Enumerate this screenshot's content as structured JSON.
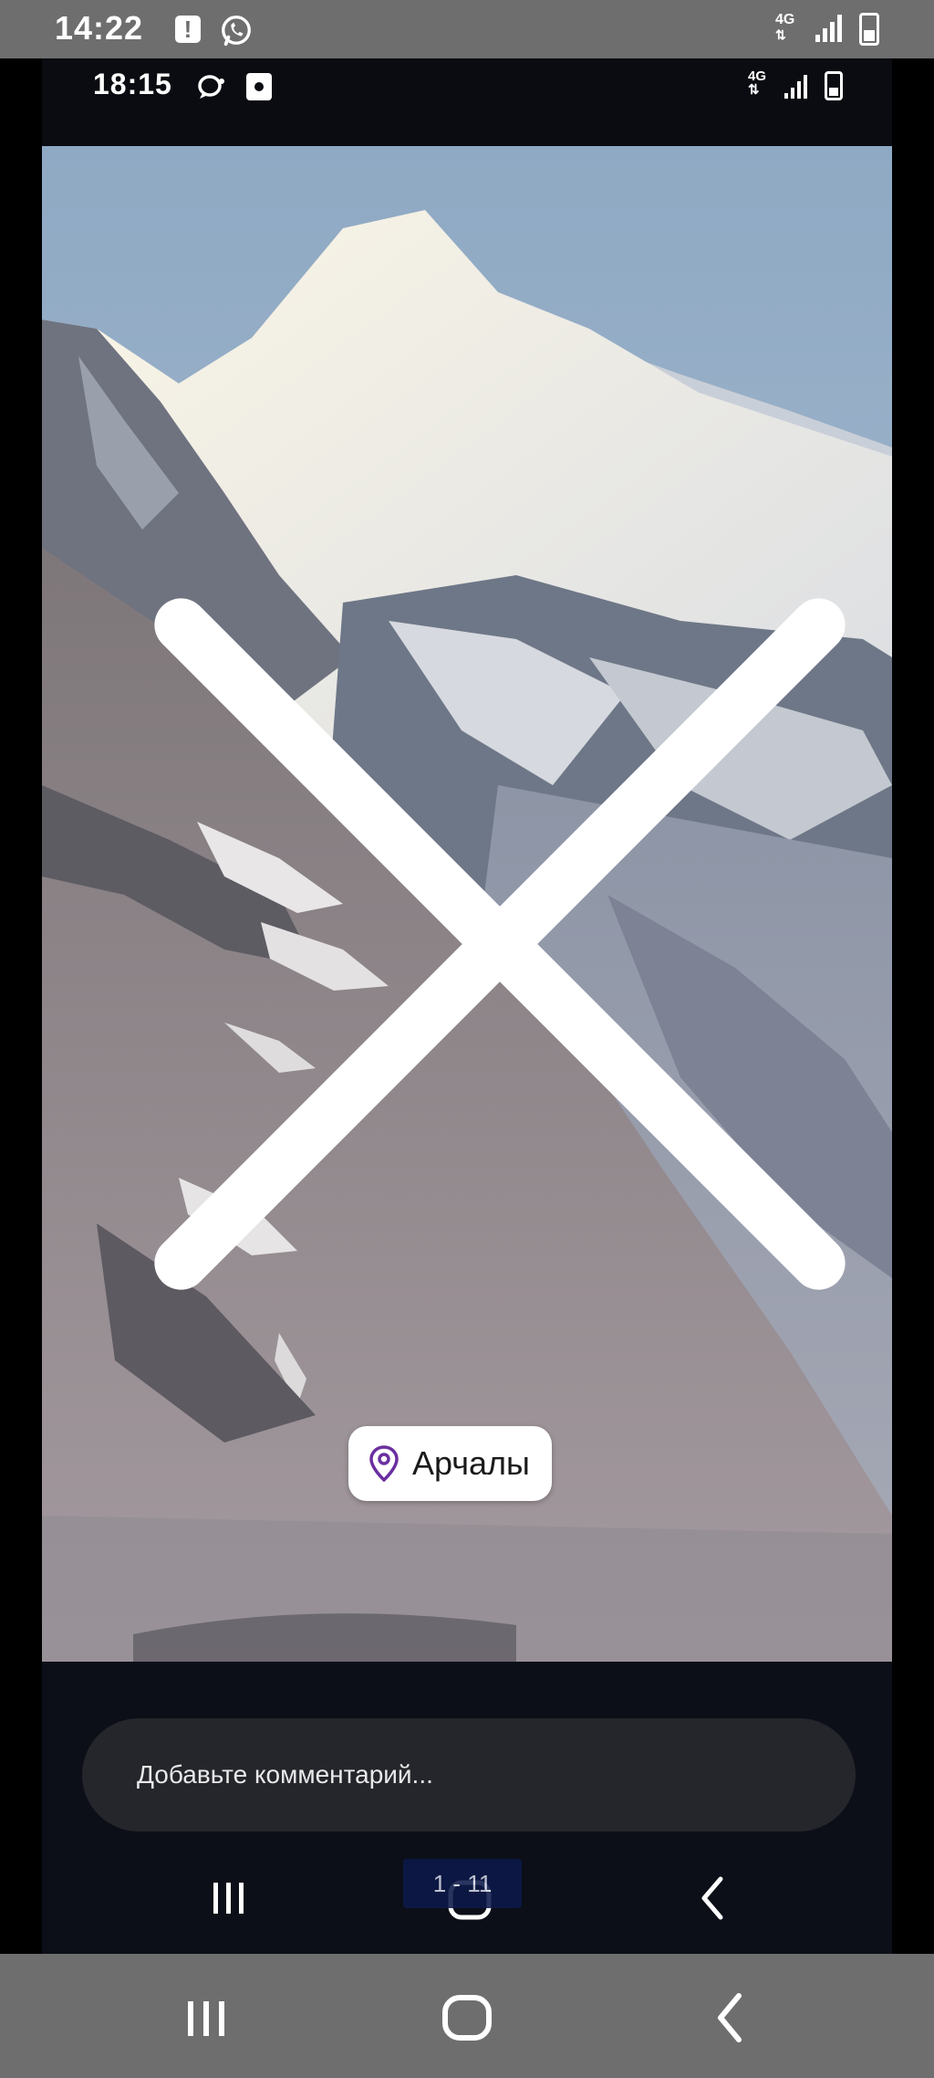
{
  "outer_status": {
    "time": "14:22",
    "network": "4G",
    "icons": [
      "alert-icon",
      "whatsapp-icon",
      "signal-icon",
      "battery-icon"
    ]
  },
  "inner_status": {
    "time": "18:15",
    "network": "4G",
    "icons": [
      "chat-icon",
      "notification-square-icon",
      "signal-icon",
      "battery-icon"
    ]
  },
  "story": {
    "close_icon": "close-icon",
    "location": {
      "icon": "map-pin-icon",
      "label": "Арчалы",
      "color": "#6b2fa0"
    }
  },
  "comment": {
    "placeholder": "Добавьте комментарий..."
  },
  "inner_nav": {
    "counter": "1 - 11",
    "buttons": [
      "recents-icon",
      "home-icon",
      "back-icon"
    ]
  },
  "outer_nav": {
    "buttons": [
      "recents-icon",
      "home-icon",
      "back-icon"
    ]
  }
}
